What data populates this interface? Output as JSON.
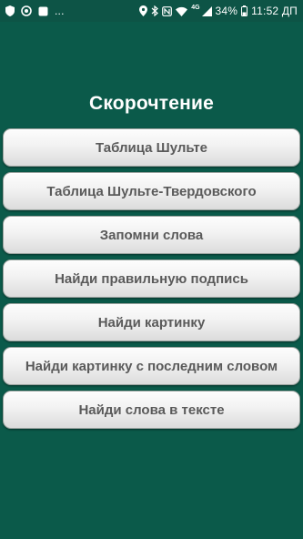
{
  "status_bar": {
    "notification_overflow": "...",
    "network_small": "4G",
    "battery_percent": "34%",
    "time": "11:52 ДП"
  },
  "screen": {
    "title": "Скорочтение",
    "menu_items": [
      {
        "label": "Таблица Шульте"
      },
      {
        "label": "Таблица Шульте-Твердовского"
      },
      {
        "label": "Запомни слова"
      },
      {
        "label": "Найди правильную подпись"
      },
      {
        "label": "Найди картинку"
      },
      {
        "label": "Найди картинку с последним словом"
      },
      {
        "label": "Найди слова в тексте"
      }
    ]
  },
  "colors": {
    "background": "#0b5a4a",
    "status_bar": "#0d5446",
    "button_text": "#5a5a5a",
    "title_text": "#ffffff"
  },
  "icons": {
    "status_left": [
      "shield-icon",
      "sync-icon",
      "notification-icon"
    ],
    "status_right": [
      "location-icon",
      "bluetooth-icon",
      "nfc-icon",
      "wifi-icon",
      "signal-icon",
      "battery-icon"
    ]
  }
}
